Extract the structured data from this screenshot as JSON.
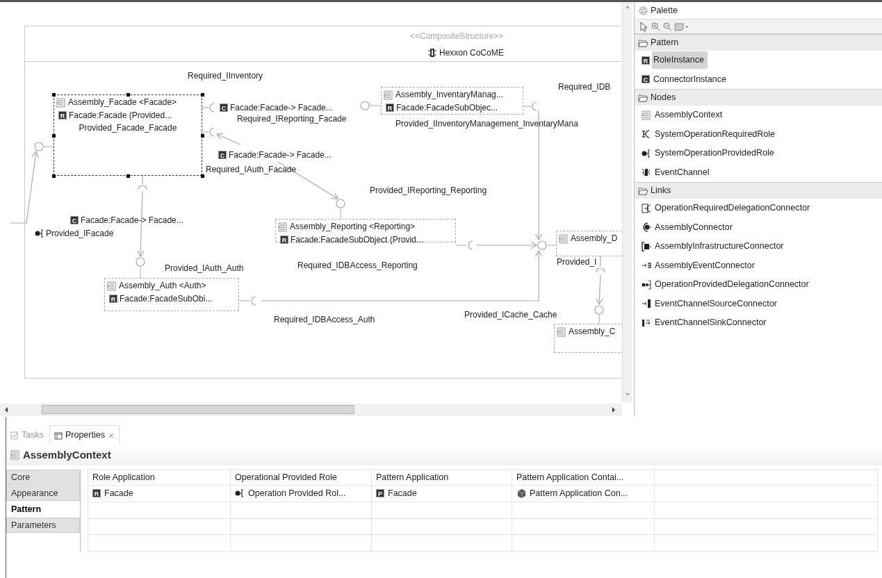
{
  "diagram": {
    "stereotype": "<<CompositeStructure>>",
    "system": {
      "name": "Hexxon CoCoME"
    },
    "components": [
      {
        "name": "Assembly_Facade <Facade>",
        "badge": "R",
        "role": "Facade:Facade (Provided...",
        "note": "Provided_Facade_Facade",
        "selected": true
      },
      {
        "name": "Assembly_InventaryManag...",
        "badge": "R",
        "role": "Facade:FacadeSubObjec...",
        "selected": false
      },
      {
        "name": "Assembly_Reporting <Reporting>",
        "badge": "R",
        "role": "Facade:FacadeSubObject (Provid...",
        "selected": false
      },
      {
        "name": "Assembly_Auth <Auth>",
        "badge": "R",
        "role": "Facade:FacadeSubObi...",
        "selected": false
      },
      {
        "name": "Assembly_D",
        "selected": false
      },
      {
        "name": "Assembly_C",
        "selected": false
      }
    ],
    "connectors": [
      {
        "badge": "C",
        "text": "Facade:Facade-> Facade..."
      },
      {
        "badge": "C",
        "text": "Facade:Facade-> Facade..."
      },
      {
        "badge": "C",
        "text": "Facade:Facade-> Facade..."
      }
    ],
    "system_role": {
      "text": "Provided_IFacade"
    },
    "labels": [
      "Required_IInventory",
      "Required_IReporting_Facade",
      "Required_IDB",
      "Provided_IInventoryManagement_InventaryMana",
      "Required_IAuth_Facade",
      "Provided_IReporting_Reporting",
      "Provided_IAuth_Auth",
      "Required_IDBAccess_Reporting",
      "Provided_I",
      "Provided_ICache_Cache",
      "Required_IDBAccess_Auth"
    ]
  },
  "palette": {
    "title": "Palette",
    "groups": [
      {
        "name": "Pattern",
        "items": [
          {
            "label": "RoleInstance",
            "badge": "R",
            "selected": true
          },
          {
            "label": "ConnectorInstance",
            "badge": "C",
            "selected": false
          }
        ]
      },
      {
        "name": "Nodes",
        "items": [
          {
            "label": "AssemblyContext",
            "kind": "assembly",
            "selected": false
          },
          {
            "label": "SystemOperationRequiredRole",
            "kind": "required",
            "selected": false
          },
          {
            "label": "SystemOperationProvidedRole",
            "kind": "provided",
            "selected": false
          },
          {
            "label": "EventChannel",
            "kind": "channel",
            "selected": false
          }
        ]
      },
      {
        "name": "Links",
        "items": [
          {
            "label": "OperationRequiredDelegationConnector",
            "kind": "reqdeleg",
            "selected": false
          },
          {
            "label": "AssemblyConnector",
            "kind": "assemblyconn",
            "selected": false
          },
          {
            "label": "AssemblyInfrastructureConnector",
            "kind": "infra",
            "selected": false
          },
          {
            "label": "AssemblyEventConnector",
            "kind": "eventconn",
            "selected": false
          },
          {
            "label": "OperationProvidedDelegationConnector",
            "kind": "provdeleg",
            "selected": false
          },
          {
            "label": "EventChannelSourceConnector",
            "kind": "source",
            "selected": false
          },
          {
            "label": "EventChannelSinkConnector",
            "kind": "sink",
            "selected": false
          }
        ]
      }
    ]
  },
  "properties": {
    "tabs": [
      {
        "label": "Tasks",
        "selected": false
      },
      {
        "label": "Properties",
        "selected": true
      }
    ],
    "title": "AssemblyContext",
    "sections": [
      {
        "label": "Core",
        "selected": false
      },
      {
        "label": "Appearance",
        "selected": false
      },
      {
        "label": "Pattern",
        "selected": true
      },
      {
        "label": "Parameters",
        "selected": false
      }
    ],
    "table": {
      "columns": [
        "Role Application",
        "Operational Provided Role",
        "Pattern Application",
        "Pattern Application Contai..."
      ],
      "rows": [
        [
          {
            "badge": "R",
            "text": "Facade"
          },
          {
            "kind": "provided",
            "text": "Operation Provided Rol..."
          },
          {
            "badge": "P",
            "text": "Facade"
          },
          {
            "kind": "container",
            "text": "Pattern Application Con..."
          }
        ]
      ]
    }
  }
}
